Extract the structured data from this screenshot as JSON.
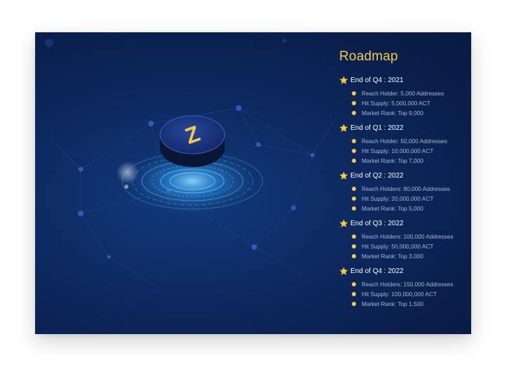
{
  "roadmap": {
    "title": "Roadmap",
    "logo_letter": "Z",
    "accent_color": "#f2c94c",
    "milestones": [
      {
        "label": "End of Q4 : 2021",
        "items": [
          "Reach Holder: 5,000 Addresses",
          "Hit Supply: 5,000,000 ACT",
          "Market Rank: Top 9,000"
        ]
      },
      {
        "label": "End of Q1 : 2022",
        "items": [
          "Reach Holder: 50,000 Addresses",
          "Hit Supply: 10,000,000 ACT",
          "Market Rank: Top 7,000"
        ]
      },
      {
        "label": "End of Q2 : 2022",
        "items": [
          "Reach Holders: 80,000 Addresses",
          "Hit Supply: 20,000,000 ACT",
          "Market Rank: Top 5,000"
        ]
      },
      {
        "label": "End of Q3 : 2022",
        "items": [
          "Reach Holders: 100,000 Addresses",
          "Hit Supply: 50,000,000 ACT",
          "Market Rank: Top 3,000"
        ]
      },
      {
        "label": "End of Q4 : 2022",
        "items": [
          "Reach Holders: 150,000 Addresses",
          "Hit Supply: 100,000,000 ACT",
          "Market Rank: Top 1,500"
        ]
      }
    ]
  }
}
